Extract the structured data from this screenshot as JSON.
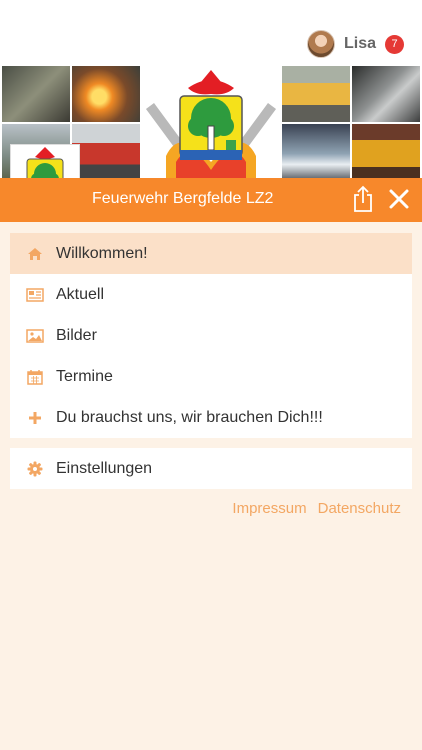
{
  "user": {
    "name": "Lisa",
    "notifications": "7"
  },
  "header": {
    "title": "Feuerwehr Bergfelde LZ2"
  },
  "menu": {
    "items": [
      {
        "label": "Willkommen!",
        "icon": "home-icon"
      },
      {
        "label": "Aktuell",
        "icon": "newspaper-icon"
      },
      {
        "label": "Bilder",
        "icon": "image-icon"
      },
      {
        "label": "Termine",
        "icon": "calendar-icon"
      },
      {
        "label": "Du brauchst uns, wir brauchen Dich!!!",
        "icon": "plus-icon"
      }
    ],
    "settings": {
      "label": "Einstellungen",
      "icon": "gear-icon"
    }
  },
  "footer": {
    "impressum": "Impressum",
    "datenschutz": "Datenschutz"
  },
  "colors": {
    "accent": "#f7882b",
    "background": "#fdf2e6",
    "active": "#fbe0c8",
    "badge": "#e53935"
  }
}
